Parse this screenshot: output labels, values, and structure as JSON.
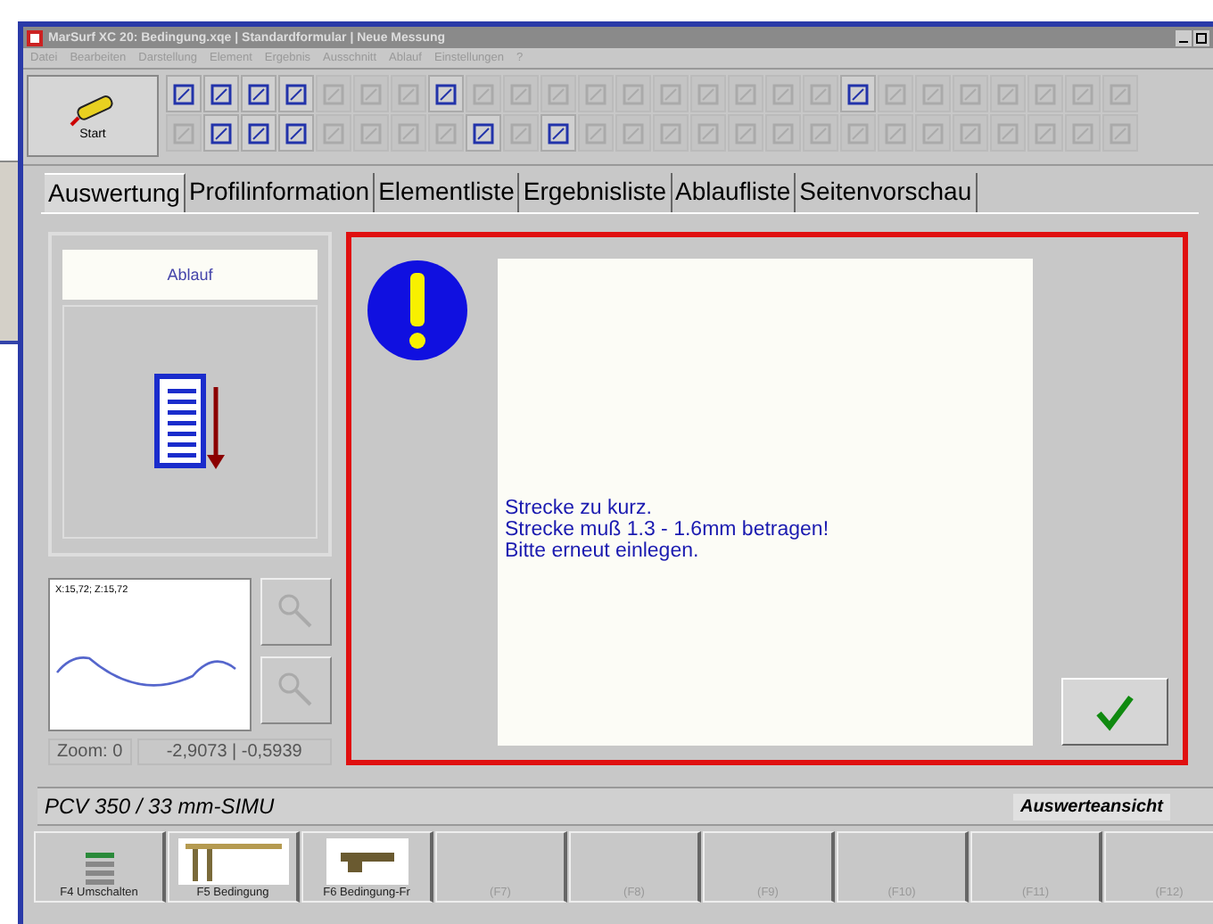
{
  "window": {
    "title": "MarSurf XC 20: Bedingung.xqe | Standardformular | Neue Messung"
  },
  "menu": [
    "Datei",
    "Bearbeiten",
    "Darstellung",
    "Element",
    "Ergebnis",
    "Ausschnitt",
    "Ablauf",
    "Einstellungen",
    "?"
  ],
  "toolbar": {
    "start_label": "Start",
    "row_1": [
      {
        "disabled": false
      },
      {
        "disabled": false
      },
      {
        "disabled": false
      },
      {
        "disabled": false
      },
      {
        "disabled": true
      },
      {
        "disabled": true
      },
      {
        "disabled": true
      },
      {
        "disabled": false
      },
      {
        "disabled": true
      },
      {
        "disabled": true
      },
      {
        "disabled": true
      },
      {
        "disabled": true
      },
      {
        "disabled": true
      },
      {
        "disabled": true
      },
      {
        "disabled": true
      },
      {
        "disabled": true
      },
      {
        "disabled": true
      },
      {
        "disabled": true
      },
      {
        "disabled": false
      },
      {
        "disabled": true
      },
      {
        "disabled": true
      },
      {
        "disabled": true
      },
      {
        "disabled": true
      },
      {
        "disabled": true
      },
      {
        "disabled": true
      },
      {
        "disabled": true
      }
    ],
    "row_2": [
      {
        "disabled": true
      },
      {
        "disabled": false
      },
      {
        "disabled": false
      },
      {
        "disabled": false
      },
      {
        "disabled": true
      },
      {
        "disabled": true
      },
      {
        "disabled": true
      },
      {
        "disabled": true
      },
      {
        "disabled": false
      },
      {
        "disabled": true
      },
      {
        "disabled": false
      },
      {
        "disabled": true
      },
      {
        "disabled": true
      },
      {
        "disabled": true
      },
      {
        "disabled": true
      },
      {
        "disabled": true
      },
      {
        "disabled": true
      },
      {
        "disabled": true
      },
      {
        "disabled": true
      },
      {
        "disabled": true
      },
      {
        "disabled": true
      },
      {
        "disabled": true
      },
      {
        "disabled": true
      },
      {
        "disabled": true
      },
      {
        "disabled": true
      },
      {
        "disabled": true
      }
    ]
  },
  "tabs": [
    {
      "label": "Auswertung",
      "selected": true
    },
    {
      "label": "Profilinformation",
      "selected": false
    },
    {
      "label": "Elementliste",
      "selected": false
    },
    {
      "label": "Ergebnisliste",
      "selected": false
    },
    {
      "label": "Ablaufliste",
      "selected": false
    },
    {
      "label": "Seitenvorschau",
      "selected": false
    }
  ],
  "sequence_panel": {
    "title": "Ablauf"
  },
  "profile_preview": {
    "coordinates": "X:15,72; Z:15,72",
    "zoom": "Zoom: 0",
    "position": "-2,9073 | -0,5939"
  },
  "message": {
    "lines": [
      "Strecke zu kurz.",
      "Strecke muß 1.3 - 1.6mm betragen!",
      "Bitte erneut einlegen."
    ]
  },
  "status_bar": {
    "left": "PCV 350 / 33 mm-SIMU",
    "right": "Auswerteansicht"
  },
  "function_keys": [
    {
      "label": "F4 Umschalten",
      "kind": "stack",
      "disabled": false
    },
    {
      "label": "F5 Bedingung",
      "kind": "frame",
      "disabled": false
    },
    {
      "label": "F6 Bedingung-Fr",
      "kind": "probe",
      "disabled": false
    },
    {
      "label": "(F7)",
      "kind": "blank",
      "disabled": true
    },
    {
      "label": "(F8)",
      "kind": "blank",
      "disabled": true
    },
    {
      "label": "(F9)",
      "kind": "blank",
      "disabled": true
    },
    {
      "label": "(F10)",
      "kind": "blank",
      "disabled": true
    },
    {
      "label": "(F11)",
      "kind": "blank",
      "disabled": true
    },
    {
      "label": "(F12)",
      "kind": "blank",
      "disabled": true
    }
  ]
}
